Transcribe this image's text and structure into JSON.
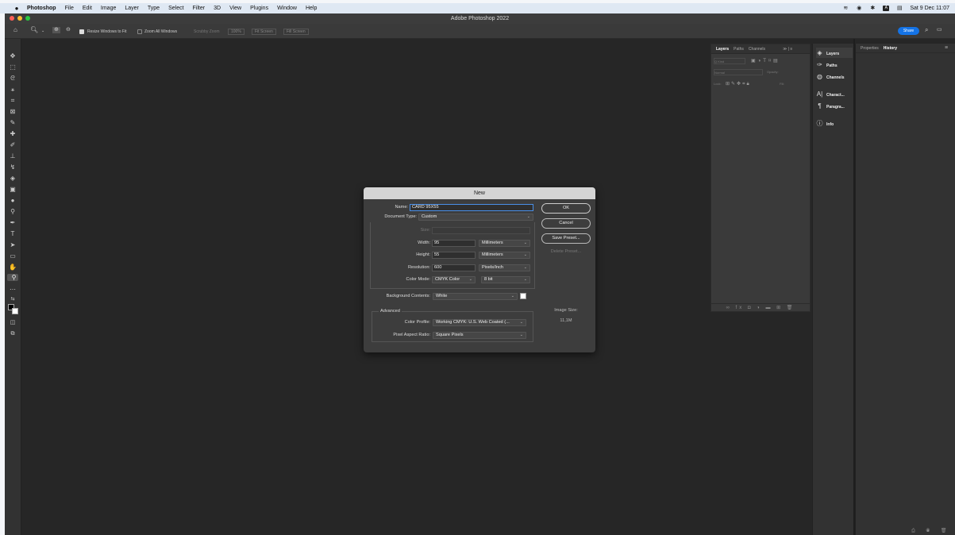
{
  "menubar": {
    "app_name": "Photoshop",
    "items": [
      "File",
      "Edit",
      "Image",
      "Layer",
      "Type",
      "Select",
      "Filter",
      "3D",
      "View",
      "Plugins",
      "Window",
      "Help"
    ],
    "datetime": "Sat 9 Dec  11:07"
  },
  "window": {
    "title": "Adobe Photoshop 2022"
  },
  "options_bar": {
    "resize_windows": "Resize Windows to Fit",
    "zoom_all": "Zoom All Windows",
    "scrubby_zoom": "Scrubby Zoom",
    "percent": "100%",
    "fit_screen": "Fit Screen",
    "fill_screen": "Fill Screen",
    "share": "Share"
  },
  "layers_panel": {
    "tabs": [
      "Layers",
      "Paths",
      "Channels"
    ],
    "kind_placeholder": "Q Kind",
    "blend_mode": "Normal",
    "opacity_label": "Opacity:",
    "lock_label": "Lock:",
    "fill_label": "Fill:"
  },
  "dock": {
    "items": [
      {
        "label": "Layers",
        "icon": "layers-icon"
      },
      {
        "label": "Paths",
        "icon": "paths-icon"
      },
      {
        "label": "Channels",
        "icon": "channels-icon"
      },
      {
        "label": "Charact...",
        "icon": "character-icon"
      },
      {
        "label": "Paragra...",
        "icon": "paragraph-icon"
      },
      {
        "label": "Info",
        "icon": "info-icon"
      }
    ]
  },
  "right_panel": {
    "tabs": [
      "Properties",
      "History"
    ]
  },
  "dialog": {
    "title": "New",
    "name_label": "Name:",
    "name_value": "CARD 95X55",
    "doc_type_label": "Document Type:",
    "doc_type_value": "Custom",
    "size_label": "Size:",
    "width_label": "Width:",
    "width_value": "95",
    "width_unit": "Millimeters",
    "height_label": "Height:",
    "height_value": "55",
    "height_unit": "Millimeters",
    "resolution_label": "Resolution:",
    "resolution_value": "600",
    "resolution_unit": "Pixels/Inch",
    "color_mode_label": "Color Mode:",
    "color_mode_value": "CMYK Color",
    "bit_depth": "8 bit",
    "bg_label": "Background Contents:",
    "bg_value": "White",
    "advanced": "Advanced",
    "profile_label": "Color Profile:",
    "profile_value": "Working CMYK:  U.S. Web Coated (...",
    "pixel_aspect_label": "Pixel Aspect Ratio:",
    "pixel_aspect_value": "Square Pixels",
    "ok": "OK",
    "cancel": "Cancel",
    "save_preset": "Save Preset...",
    "delete_preset": "Delete Preset...",
    "image_size_label": "Image Size:",
    "image_size_value": "11,1M"
  }
}
